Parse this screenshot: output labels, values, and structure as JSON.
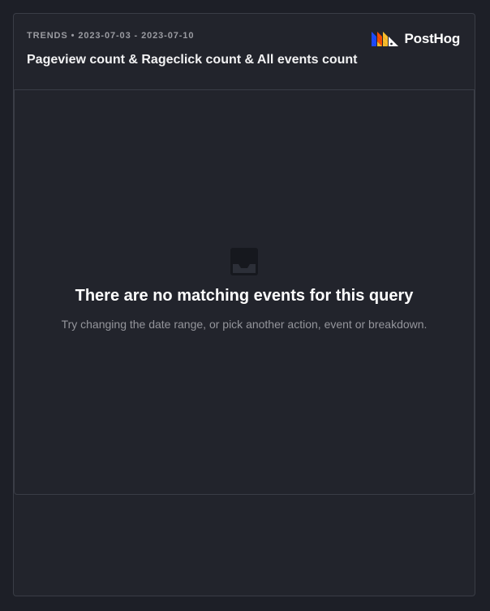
{
  "insight": {
    "kind": "TRENDS",
    "separator": "•",
    "date_range": "2023-07-03 - 2023-07-10",
    "title": "Pageview count & Rageclick count & All events count"
  },
  "brand": {
    "logo_icon": "posthog-logo-icon",
    "name": "PostHog"
  },
  "empty_state": {
    "icon": "inbox-icon",
    "title": "There are no matching events for this query",
    "description": "Try changing the date range, or pick another action, event or breakdown."
  },
  "colors": {
    "background": "#1d1f27",
    "card": "#22242c",
    "border": "#3a3d46",
    "text_primary": "#ffffff",
    "text_muted": "#94959b",
    "brand_blue": "#1d4aff",
    "brand_orange": "#f54e00",
    "brand_yellow": "#f9bd2b"
  }
}
